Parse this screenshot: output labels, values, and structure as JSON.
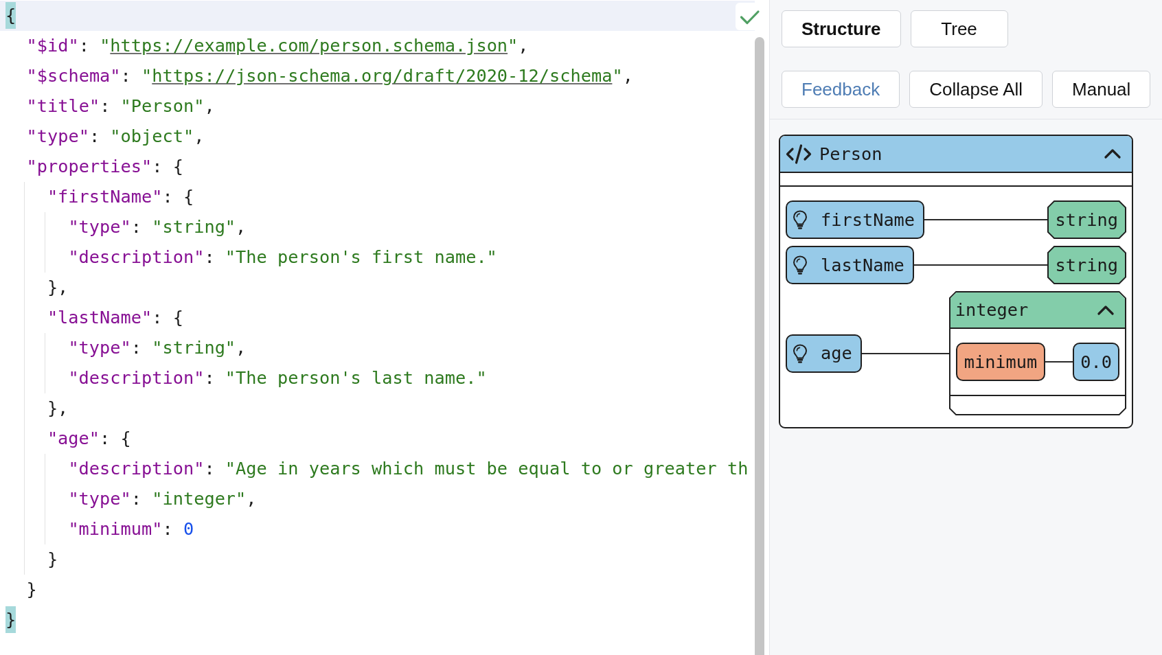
{
  "editor": {
    "valid": true,
    "lines": [
      {
        "active": true,
        "tokens": [
          {
            "kind": "match",
            "text": "{"
          }
        ],
        "children": [
          {
            "active": false,
            "tokens": [
              {
                "kind": "key",
                "text": "\"$id\""
              },
              {
                "kind": "punct",
                "text": ": "
              },
              {
                "kind": "string",
                "text": "\""
              },
              {
                "kind": "link",
                "text": "https://example.com/person.schema.json"
              },
              {
                "kind": "string",
                "text": "\""
              },
              {
                "kind": "punct",
                "text": ","
              }
            ]
          },
          {
            "active": false,
            "tokens": [
              {
                "kind": "key",
                "text": "\"$schema\""
              },
              {
                "kind": "punct",
                "text": ": "
              },
              {
                "kind": "string",
                "text": "\""
              },
              {
                "kind": "link",
                "text": "https://json-schema.org/draft/2020-12/schema"
              },
              {
                "kind": "string",
                "text": "\""
              },
              {
                "kind": "punct",
                "text": ","
              }
            ]
          },
          {
            "active": false,
            "tokens": [
              {
                "kind": "key",
                "text": "\"title\""
              },
              {
                "kind": "punct",
                "text": ": "
              },
              {
                "kind": "string",
                "text": "\"Person\""
              },
              {
                "kind": "punct",
                "text": ","
              }
            ]
          },
          {
            "active": false,
            "tokens": [
              {
                "kind": "key",
                "text": "\"type\""
              },
              {
                "kind": "punct",
                "text": ": "
              },
              {
                "kind": "string",
                "text": "\"object\""
              },
              {
                "kind": "punct",
                "text": ","
              }
            ]
          },
          {
            "active": false,
            "tokens": [
              {
                "kind": "key",
                "text": "\"properties\""
              },
              {
                "kind": "punct",
                "text": ": {"
              }
            ],
            "children": [
              {
                "active": false,
                "tokens": [
                  {
                    "kind": "key",
                    "text": "\"firstName\""
                  },
                  {
                    "kind": "punct",
                    "text": ": {"
                  }
                ],
                "children": [
                  {
                    "active": false,
                    "tokens": [
                      {
                        "kind": "key",
                        "text": "\"type\""
                      },
                      {
                        "kind": "punct",
                        "text": ": "
                      },
                      {
                        "kind": "string",
                        "text": "\"string\""
                      },
                      {
                        "kind": "punct",
                        "text": ","
                      }
                    ]
                  },
                  {
                    "active": false,
                    "tokens": [
                      {
                        "kind": "key",
                        "text": "\"description\""
                      },
                      {
                        "kind": "punct",
                        "text": ": "
                      },
                      {
                        "kind": "string",
                        "text": "\"The person's first name.\""
                      }
                    ]
                  }
                ]
              },
              {
                "active": false,
                "tokens": [
                  {
                    "kind": "punct",
                    "text": "},"
                  }
                ]
              },
              {
                "active": false,
                "tokens": [
                  {
                    "kind": "key",
                    "text": "\"lastName\""
                  },
                  {
                    "kind": "punct",
                    "text": ": {"
                  }
                ],
                "children": [
                  {
                    "active": false,
                    "tokens": [
                      {
                        "kind": "key",
                        "text": "\"type\""
                      },
                      {
                        "kind": "punct",
                        "text": ": "
                      },
                      {
                        "kind": "string",
                        "text": "\"string\""
                      },
                      {
                        "kind": "punct",
                        "text": ","
                      }
                    ]
                  },
                  {
                    "active": false,
                    "tokens": [
                      {
                        "kind": "key",
                        "text": "\"description\""
                      },
                      {
                        "kind": "punct",
                        "text": ": "
                      },
                      {
                        "kind": "string",
                        "text": "\"The person's last name.\""
                      }
                    ]
                  }
                ]
              },
              {
                "active": false,
                "tokens": [
                  {
                    "kind": "punct",
                    "text": "},"
                  }
                ]
              },
              {
                "active": false,
                "tokens": [
                  {
                    "kind": "key",
                    "text": "\"age\""
                  },
                  {
                    "kind": "punct",
                    "text": ": {"
                  }
                ],
                "children": [
                  {
                    "active": false,
                    "tokens": [
                      {
                        "kind": "key",
                        "text": "\"description\""
                      },
                      {
                        "kind": "punct",
                        "text": ": "
                      },
                      {
                        "kind": "string",
                        "text": "\"Age in years which must be equal to or greater th"
                      }
                    ]
                  },
                  {
                    "active": false,
                    "tokens": [
                      {
                        "kind": "key",
                        "text": "\"type\""
                      },
                      {
                        "kind": "punct",
                        "text": ": "
                      },
                      {
                        "kind": "string",
                        "text": "\"integer\""
                      },
                      {
                        "kind": "punct",
                        "text": ","
                      }
                    ]
                  },
                  {
                    "active": false,
                    "tokens": [
                      {
                        "kind": "key",
                        "text": "\"minimum\""
                      },
                      {
                        "kind": "punct",
                        "text": ": "
                      },
                      {
                        "kind": "number",
                        "text": "0"
                      }
                    ]
                  }
                ]
              },
              {
                "active": false,
                "tokens": [
                  {
                    "kind": "punct",
                    "text": "}"
                  }
                ]
              }
            ]
          },
          {
            "active": false,
            "tokens": [
              {
                "kind": "punct",
                "text": "}"
              }
            ]
          }
        ]
      },
      {
        "active": false,
        "tokens": [
          {
            "kind": "match",
            "text": "}"
          }
        ]
      }
    ]
  },
  "schema_view": {
    "tabs": [
      {
        "label": "Structure",
        "selected": true
      },
      {
        "label": "Tree",
        "selected": false
      }
    ],
    "toolbar": [
      {
        "label": "Feedback",
        "kind": "link"
      },
      {
        "label": "Collapse All",
        "kind": "action"
      },
      {
        "label": "Manual",
        "kind": "action"
      }
    ],
    "diagram": {
      "title": "Person",
      "expanded": true,
      "properties": [
        {
          "name": "firstName",
          "type": {
            "kind": "simple",
            "label": "string"
          }
        },
        {
          "name": "lastName",
          "type": {
            "kind": "simple",
            "label": "string"
          }
        },
        {
          "name": "age",
          "type": {
            "kind": "group",
            "label": "integer",
            "expanded": true,
            "constraints": [
              {
                "name": "minimum",
                "value": "0.0"
              }
            ]
          }
        }
      ]
    }
  }
}
